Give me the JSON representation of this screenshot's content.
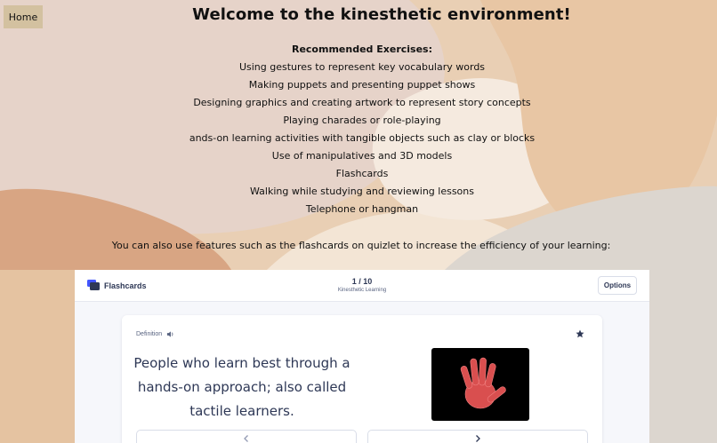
{
  "nav": {
    "home_label": "Home"
  },
  "page": {
    "title": "Welcome to the kinesthetic environment!",
    "exercises_heading": "Recommended Exercises:",
    "exercises": [
      "Using gestures to represent key vocabulary words",
      "Making puppets and presenting puppet shows",
      "Designing graphics and creating artwork to represent story concepts",
      "Playing charades or role-playing",
      "ands-on learning activities with tangible objects such as clay or blocks",
      "Use of manipulatives and 3D models",
      "Flashcards",
      "Walking while studying and reviewing lessons",
      "Telephone or hangman"
    ],
    "quizlet_note": "You can also use features such as the flashcards on quizlet to increase the efficiency of your learning:"
  },
  "quizlet": {
    "mode_label": "Flashcards",
    "mode_icon": "flashcards-icon",
    "progress": "1 / 10",
    "set_title": "Kinesthetic Learning",
    "options_label": "Options",
    "card": {
      "side_label": "Definition",
      "text": "People who learn best through a hands-on approach; also called tactile learners.",
      "audio_icon": "speaker-icon",
      "star_icon": "star-icon",
      "image_icon": "red-handprint-image"
    },
    "prev_icon": "chevron-left-icon",
    "next_icon": "chevron-right-icon"
  },
  "colors": {
    "background": "#e9cfb4",
    "home_button": "#d3c1a0",
    "quizlet_text": "#2e3856",
    "quizlet_accent": "#4255ff",
    "handprint": "#e05a5a"
  }
}
